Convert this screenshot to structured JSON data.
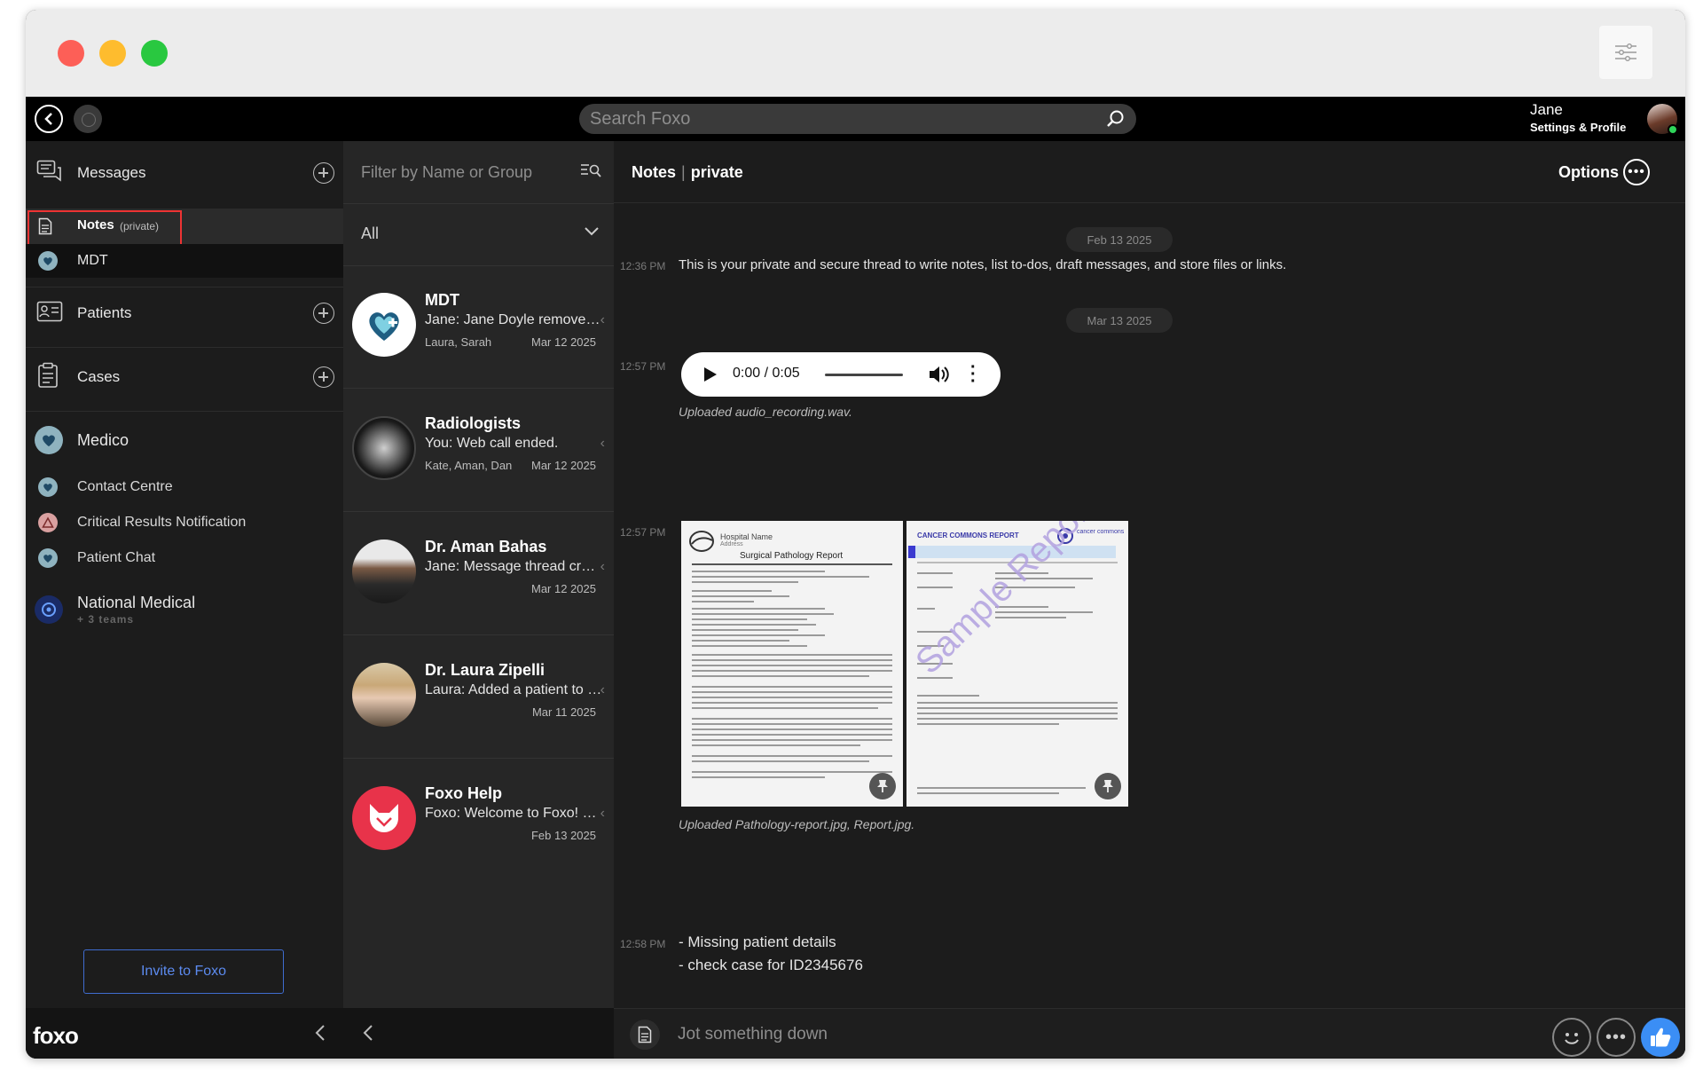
{
  "user": {
    "name": "Jane",
    "settings_label": "Settings & Profile"
  },
  "search": {
    "placeholder": "Search Foxo"
  },
  "sidebar": {
    "messages_label": "Messages",
    "notes_label": "Notes",
    "notes_tag": "(private)",
    "mdt_label": "MDT",
    "patients_label": "Patients",
    "cases_label": "Cases",
    "medico_label": "Medico",
    "medico_groups": [
      "Contact Centre",
      "Critical Results Notification",
      "Patient Chat"
    ],
    "national_label": "National Medical",
    "national_sub": "+ 3 teams",
    "invite_label": "Invite to Foxo",
    "brand": "foxo"
  },
  "list": {
    "filter_placeholder": "Filter by Name or Group",
    "select_value": "All",
    "items": [
      {
        "name": "MDT",
        "message": "Jane: Jane Doyle removed Dr. Sarah Smith",
        "members": "Laura, Sarah",
        "date": "Mar 12 2025"
      },
      {
        "name": "Radiologists",
        "message": "You: Web call ended.",
        "members": "Kate, Aman, Dan",
        "date": "Mar 12 2025"
      },
      {
        "name": "Dr. Aman Bahas",
        "message": "Jane: Message thread created by Jane",
        "members": "",
        "date": "Mar 12 2025"
      },
      {
        "name": "Dr. Laura Zipelli",
        "message": "Laura: Added a patient to the chat.",
        "members": "",
        "date": "Mar 11 2025"
      },
      {
        "name": "Foxo Help",
        "message": "Foxo: Welcome to Foxo! For live support",
        "members": "",
        "date": "Feb 13 2025"
      }
    ]
  },
  "chat": {
    "title": "Notes",
    "subtitle": "private",
    "options_label": "Options",
    "dates": [
      "Feb 13 2025",
      "Mar 13 2025"
    ],
    "messages": [
      {
        "time": "12:36 PM",
        "text": "This is your private and secure thread to write notes, list to-dos, draft messages, and store files or links."
      },
      {
        "time": "12:57 PM",
        "audio_time": "0:00 / 0:05",
        "caption": "Uploaded audio_recording.wav."
      },
      {
        "time": "12:57 PM",
        "caption": "Uploaded Pathology-report.jpg, Report.jpg."
      },
      {
        "time": "12:58 PM",
        "lines": [
          "- Missing patient details",
          "- check case for ID2345676"
        ]
      }
    ],
    "attachments": [
      {
        "hospital": "Hospital Name",
        "address": "Address",
        "title": "Surgical Pathology Report"
      },
      {
        "title": "CANCER COMMONS REPORT",
        "brand": "cancer commons",
        "watermark": "Sample Report"
      }
    ],
    "compose_placeholder": "Jot something down"
  },
  "colors": {
    "accent": "#3b8ef5",
    "invite_border": "#3f6ccf",
    "highlight_box": "#e33333",
    "online": "#2fd45a"
  }
}
